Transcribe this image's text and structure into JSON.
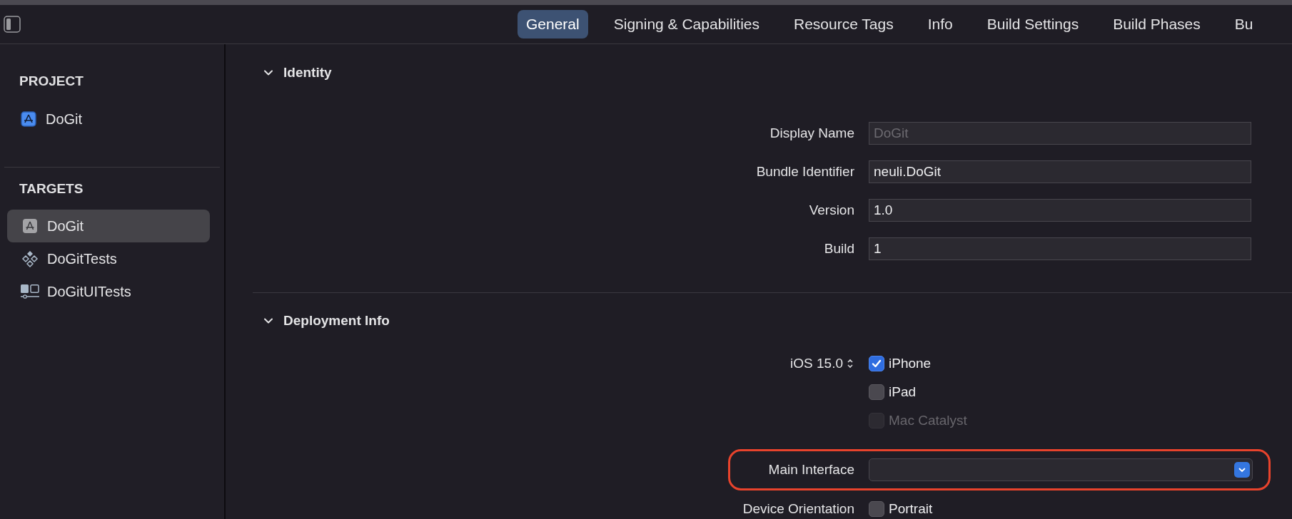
{
  "toolbar": {
    "tabs": [
      {
        "label": "General",
        "selected": true
      },
      {
        "label": "Signing & Capabilities",
        "selected": false
      },
      {
        "label": "Resource Tags",
        "selected": false
      },
      {
        "label": "Info",
        "selected": false
      },
      {
        "label": "Build Settings",
        "selected": false
      },
      {
        "label": "Build Phases",
        "selected": false
      },
      {
        "label": "Bu",
        "selected": false
      }
    ]
  },
  "sidebar": {
    "sections": [
      {
        "title": "PROJECT",
        "items": [
          {
            "label": "DoGit",
            "kind": "project",
            "selected": false
          }
        ]
      },
      {
        "title": "TARGETS",
        "items": [
          {
            "label": "DoGit",
            "kind": "app",
            "selected": true
          },
          {
            "label": "DoGitTests",
            "kind": "tests",
            "selected": false
          },
          {
            "label": "DoGitUITests",
            "kind": "uitests",
            "selected": false
          }
        ]
      }
    ]
  },
  "sections": [
    {
      "kind": "fields",
      "title": "Identity",
      "expanded": true,
      "fields": [
        {
          "label": "Display Name",
          "placeholder": "DoGit"
        },
        {
          "label": "Bundle Identifier",
          "value": "neuli.DoGit"
        },
        {
          "label": "Version",
          "value": "1.0"
        },
        {
          "label": "Build",
          "value": "1"
        }
      ]
    },
    {
      "kind": "deployment",
      "title": "Deployment Info",
      "expanded": true,
      "ios_version": "iOS 15.0",
      "devices": [
        {
          "label": "iPhone",
          "checked": true,
          "disabled": false
        },
        {
          "label": "iPad",
          "checked": false,
          "disabled": false
        },
        {
          "label": "Mac Catalyst",
          "checked": false,
          "disabled": true
        }
      ],
      "main_interface": {
        "label": "Main Interface",
        "highlighted": true
      },
      "device_orientation": {
        "label": "Device Orientation",
        "options": [
          {
            "label": "Portrait",
            "checked": false
          }
        ]
      }
    }
  ]
}
